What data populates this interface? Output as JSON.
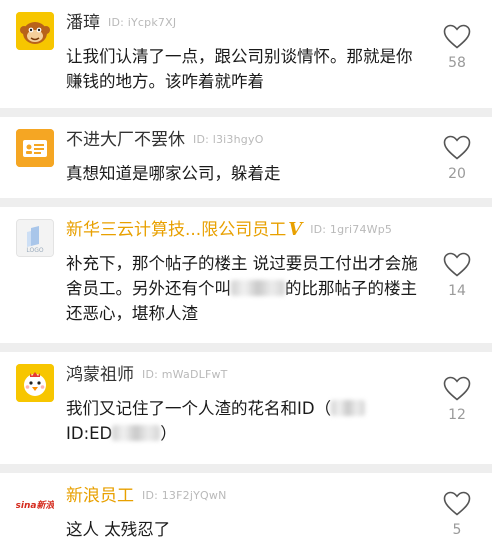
{
  "comments": [
    {
      "name": "潘璋",
      "id_label": "ID: iYcpk7XJ",
      "text_lines": [
        "让我们认清了一点，跟公司别谈情怀。那就是你",
        "赚钱的地方。该咋着就咋着"
      ],
      "likes": "58",
      "name_color": "#333333",
      "avatar_icon": "monkey-icon"
    },
    {
      "name": "不进大厂不罢休",
      "id_label": "ID: l3i3hgyO",
      "text_lines": [
        "真想知道是哪家公司，躲着走"
      ],
      "likes": "20",
      "name_color": "#333333",
      "avatar_icon": "id-card-icon"
    },
    {
      "name": "新华三云计算技...限公司员工",
      "verified": "V",
      "id_label": "ID: 1gri74Wp5",
      "text_lines": [
        "补充下，那个帖子的楼主 说过要员工付出才会施",
        "舍员工。另外还有个叫",
        "的比那帖子的楼主",
        "还恶心，堪称人渣"
      ],
      "likes": "14",
      "name_color": "#e8a000",
      "avatar_icon": "logo-placeholder-icon",
      "avatar_text": "LOGO"
    },
    {
      "name": "鸿蒙祖师",
      "id_label": "ID: mWaDLFwT",
      "text_lines": [
        "我们又记住了一个人渣的花名和ID（",
        "ID:ED",
        "）"
      ],
      "likes": "12",
      "name_color": "#333333",
      "avatar_icon": "chick-icon"
    },
    {
      "name": "新浪员工",
      "id_label": "ID: 13F2jYQwN",
      "text_lines": [
        "这人 太残忍了"
      ],
      "likes": "5",
      "name_color": "#e8a000",
      "avatar_icon": "sina-logo-icon",
      "avatar_text": "sina新浪"
    }
  ]
}
